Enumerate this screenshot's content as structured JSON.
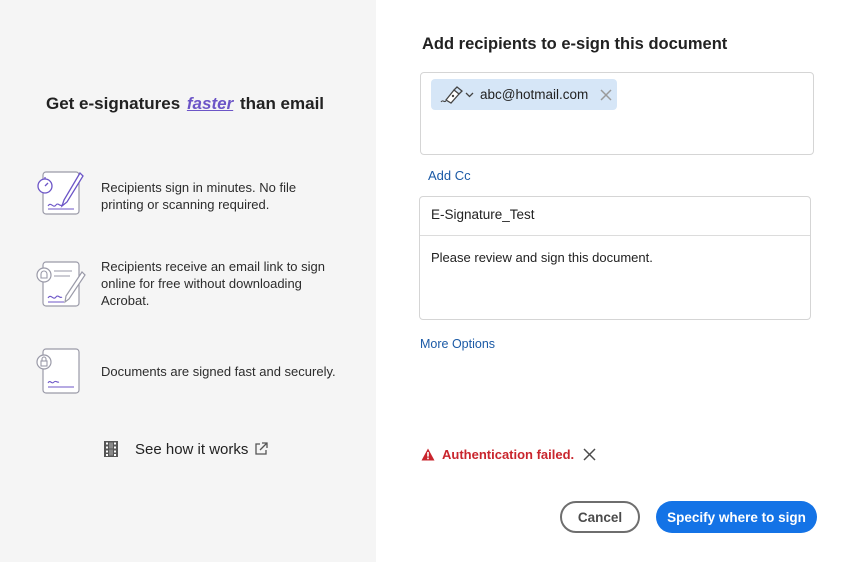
{
  "left_panel": {
    "headline_pre": "Get e-signatures",
    "headline_emph": "faster",
    "headline_post": "than email",
    "features": [
      {
        "icon": "stopwatch-pen-document-icon",
        "text": "Recipients sign in minutes. No file printing or scanning required."
      },
      {
        "icon": "bell-pen-document-icon",
        "text": "Recipients receive an email link to sign online for free without downloading Acrobat."
      },
      {
        "icon": "lock-document-icon",
        "text": "Documents are signed fast and securely."
      }
    ],
    "see_how_label": "See how it works"
  },
  "right_panel": {
    "title": "Add recipients to e-sign this document",
    "recipient_email": "abc@hotmail.com",
    "add_cc_label": "Add Cc",
    "subject": "E-Signature_Test",
    "message": "Please review and sign this document.",
    "more_options_label": "More Options",
    "error_text": "Authentication failed.",
    "cancel_label": "Cancel",
    "primary_label": "Specify where to sign"
  },
  "colors": {
    "accent": "#1473e6",
    "link": "#1b5aa6",
    "error": "#c9252d",
    "emphasis": "#6c55c7",
    "chip_bg": "#d6e6f7",
    "left_bg": "#f5f5f5"
  }
}
